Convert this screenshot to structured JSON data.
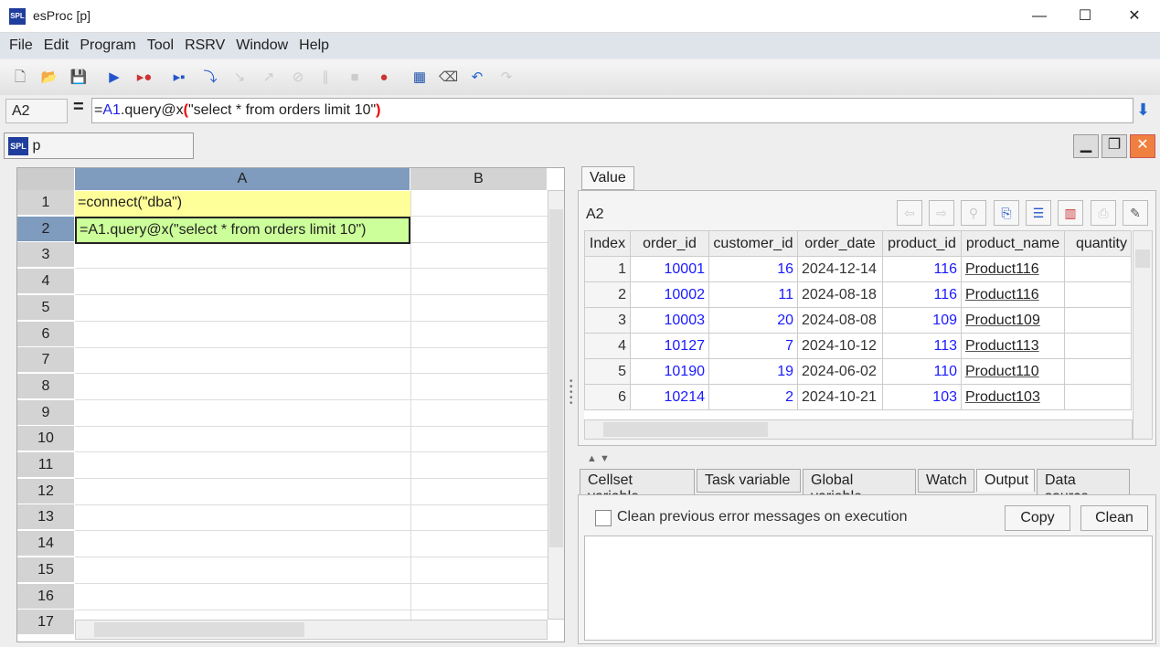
{
  "window": {
    "title": "esProc  [p]",
    "logo": "SPL"
  },
  "menu": [
    "File",
    "Edit",
    "Program",
    "Tool",
    "RSRV",
    "Window",
    "Help"
  ],
  "toolbar_icons": [
    "new-file-icon",
    "open-folder-icon",
    "save-icon",
    "run-icon",
    "run-to-breakpoint-icon",
    "step-icon",
    "step-into-icon",
    "step-over-icon",
    "step-out-icon",
    "stop-debug-icon",
    "pause-icon",
    "stop-icon",
    "breakpoint-icon",
    "calculator-icon",
    "eraser-icon",
    "undo-icon",
    "redo-icon"
  ],
  "formula": {
    "cell": "A2",
    "eq": "=",
    "prefix": "=",
    "ref": "A1",
    "method": ".query@x",
    "lparen": "(",
    "arg": "\"select * from orders limit 10\"",
    "rparen": ")"
  },
  "sheet": {
    "name": "p",
    "logo": "SPL"
  },
  "grid": {
    "columns": [
      "A",
      "B"
    ],
    "rows": [
      "1",
      "2",
      "3",
      "4",
      "5",
      "6",
      "7",
      "8",
      "9",
      "10",
      "11",
      "12",
      "13",
      "14",
      "15",
      "16",
      "17"
    ],
    "cells": {
      "A1": "=connect(\"dba\")",
      "A2": "=A1.query@x(\"select * from orders limit 10\")"
    },
    "cell_colors": {
      "A1": "#ffff99",
      "A2": "#ccff99"
    }
  },
  "value_panel": {
    "tab": "Value",
    "cell": "A2",
    "columns": [
      "Index",
      "order_id",
      "customer_id",
      "order_date",
      "product_id",
      "product_name",
      "quantity"
    ],
    "rows": [
      [
        "1",
        "10001",
        "16",
        "2024-12-14",
        "116",
        "Product116"
      ],
      [
        "2",
        "10002",
        "11",
        "2024-08-18",
        "116",
        "Product116"
      ],
      [
        "3",
        "10003",
        "20",
        "2024-08-08",
        "109",
        "Product109"
      ],
      [
        "4",
        "10127",
        "7",
        "2024-10-12",
        "113",
        "Product113"
      ],
      [
        "5",
        "10190",
        "19",
        "2024-06-02",
        "110",
        "Product110"
      ],
      [
        "6",
        "10214",
        "2",
        "2024-10-21",
        "103",
        "Product103"
      ]
    ]
  },
  "bottom_tabs": [
    "Cellset variable",
    "Task variable",
    "Global variable",
    "Watch",
    "Output",
    "Data source"
  ],
  "active_bottom_tab": "Output",
  "output": {
    "checkbox_label": "Clean previous error messages on execution",
    "checked": false,
    "copy": "Copy",
    "clean": "Clean",
    "text": ""
  }
}
